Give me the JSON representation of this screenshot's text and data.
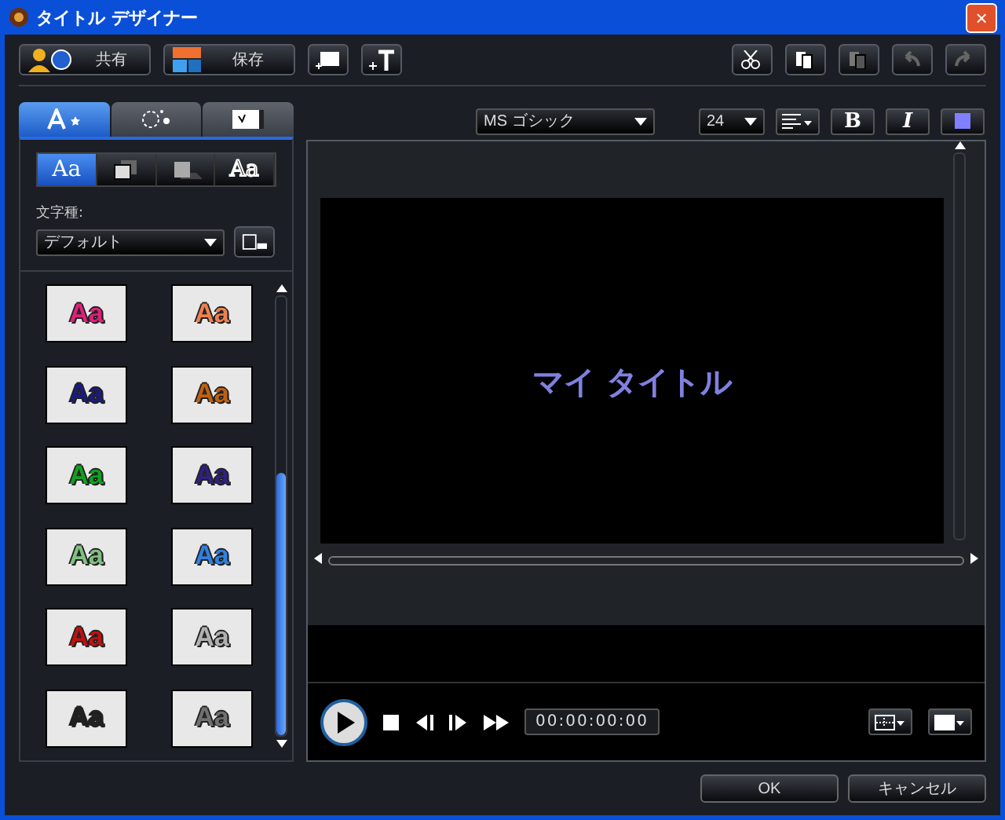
{
  "window": {
    "title": "タイトル デザイナー",
    "close": "×"
  },
  "toolbar": {
    "share": "共有",
    "save": "保存"
  },
  "tabs": [
    {
      "selected": true
    },
    {
      "selected": false
    },
    {
      "selected": false
    }
  ],
  "effect_tabs": [
    {
      "kind": "text",
      "label": "Aa",
      "selected": true
    },
    {
      "kind": "overlap",
      "selected": false
    },
    {
      "kind": "shadow",
      "selected": false
    },
    {
      "kind": "outline",
      "label": "Aa",
      "selected": false
    }
  ],
  "font_type": {
    "label": "文字種:",
    "value": "デフォルト"
  },
  "presets": [
    {
      "label": "Aa",
      "color": "#e0207a"
    },
    {
      "label": "Aa",
      "color": "#f08050"
    },
    {
      "label": "Aa",
      "color": "#1a1a80"
    },
    {
      "label": "Aa",
      "color": "#c06010"
    },
    {
      "label": "Aa",
      "color": "#10a020"
    },
    {
      "label": "Aa",
      "color": "#302080"
    },
    {
      "label": "Aa",
      "color": "#80c080"
    },
    {
      "label": "Aa",
      "color": "#3080e0"
    },
    {
      "label": "Aa",
      "color": "#c01010"
    },
    {
      "label": "Aa",
      "color": "#b0b0b0"
    },
    {
      "label": "Aa",
      "color": "#202020"
    },
    {
      "label": "Aa",
      "color": "#707070"
    }
  ],
  "format": {
    "font": "MS ゴシック",
    "size": "24",
    "bold": "B",
    "italic": "I",
    "color": "#8080ff"
  },
  "canvas": {
    "title": "マイ タイトル",
    "color": "#8080e0"
  },
  "player": {
    "time": "00:00:00:00"
  },
  "buttons": [
    "OK",
    "キャンセル"
  ]
}
